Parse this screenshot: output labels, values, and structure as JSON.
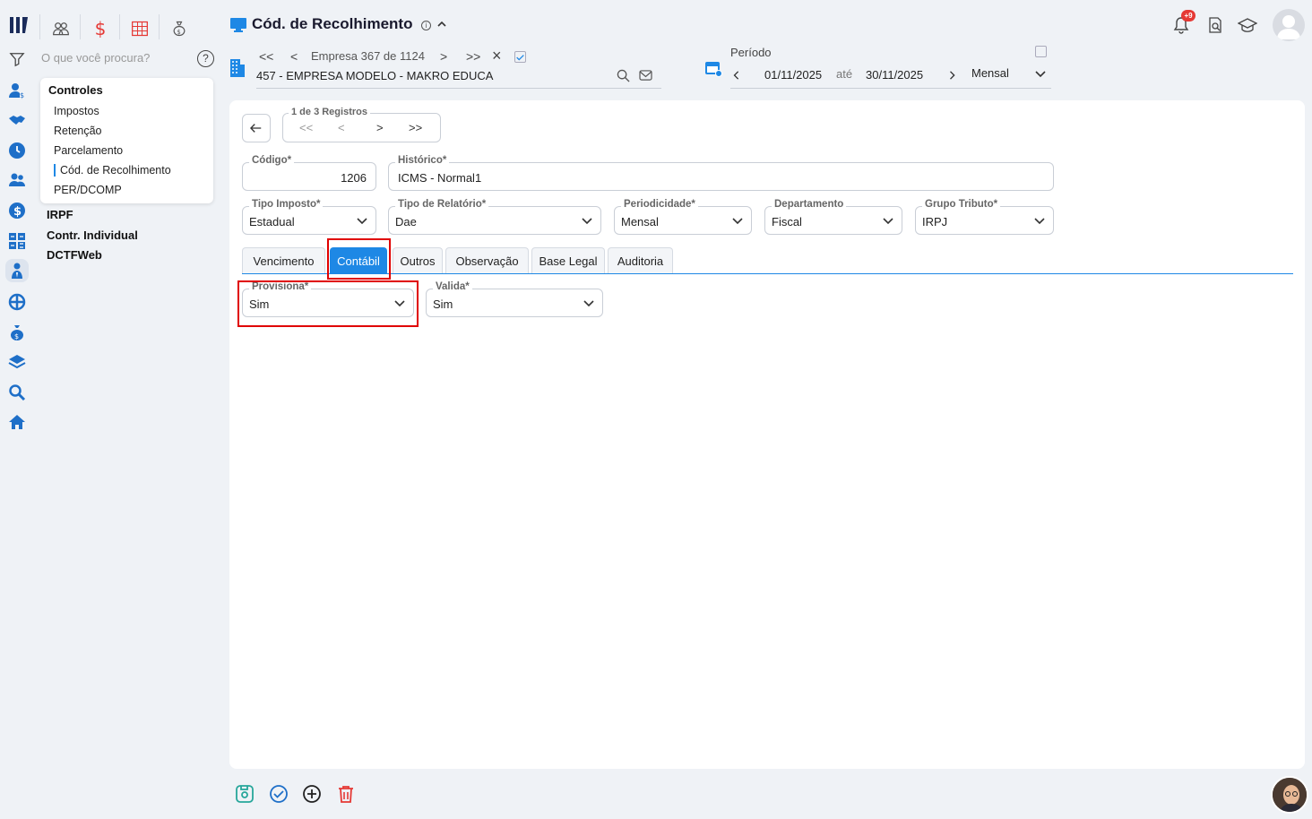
{
  "header": {
    "title": "Cód. de Recolhimento",
    "notification_count": "+9"
  },
  "search": {
    "placeholder": "O que você procura?"
  },
  "company_nav": {
    "first": "<<",
    "prev": "<",
    "label": "Empresa 367 de 1124",
    "next": ">",
    "last": ">>",
    "close": "×",
    "company": "457 - EMPRESA MODELO - MAKRO EDUCA"
  },
  "period": {
    "label": "Período",
    "start": "01/11/2025",
    "until": "até",
    "end": "30/11/2025",
    "mode": "Mensal"
  },
  "menu": {
    "section": "Controles",
    "items": [
      "Impostos",
      "Retenção",
      "Parcelamento",
      "Cód. de Recolhimento",
      "PER/DCOMP"
    ],
    "others": [
      "IRPF",
      "Contr. Individual",
      "DCTFWeb"
    ]
  },
  "record_nav": {
    "label": "1 de 3 Registros"
  },
  "form": {
    "codigo": {
      "label": "Código*",
      "value": "1206"
    },
    "historico": {
      "label": "Histórico*",
      "value": "ICMS - Normal1"
    },
    "tipo_imposto": {
      "label": "Tipo Imposto*",
      "value": "Estadual"
    },
    "tipo_relatorio": {
      "label": "Tipo de Relatório*",
      "value": "Dae"
    },
    "periodicidade": {
      "label": "Periodicidade*",
      "value": "Mensal"
    },
    "departamento": {
      "label": "Departamento",
      "value": "Fiscal"
    },
    "grupo_tributo": {
      "label": "Grupo Tributo*",
      "value": "IRPJ"
    }
  },
  "tabs": [
    "Vencimento",
    "Contábil",
    "Outros",
    "Observação",
    "Base Legal",
    "Auditoria"
  ],
  "contabil": {
    "provisiona": {
      "label": "Provisiona*",
      "value": "Sim"
    },
    "valida": {
      "label": "Valida*",
      "value": "Sim"
    }
  },
  "colors": {
    "accent": "#1e88e5",
    "highlight": "#e00000",
    "danger": "#e53935",
    "success": "#26a69a"
  }
}
